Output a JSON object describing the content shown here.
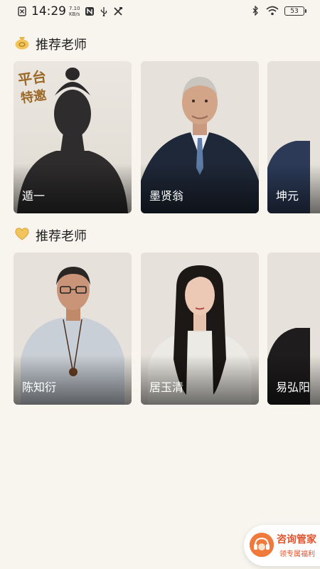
{
  "status_bar": {
    "time": "14:29",
    "net_speed_value": "7.10",
    "net_speed_unit": "KB/s",
    "battery": "53"
  },
  "sections": [
    {
      "icon": "money-bag-icon",
      "title": "推荐老师",
      "teachers": [
        {
          "name": "遁一",
          "badge_line1": "平台",
          "badge_line2": "特邀"
        },
        {
          "name": "墨贤翁"
        },
        {
          "name": "坤元"
        }
      ]
    },
    {
      "icon": "heart-icon",
      "title": "推荐老师",
      "teachers": [
        {
          "name": "陈知衍"
        },
        {
          "name": "居玉清"
        },
        {
          "name": "易弘阳"
        }
      ]
    }
  ],
  "consult": {
    "title": "咨询管家",
    "subtitle": "领专属福利"
  },
  "colors": {
    "background": "#f8f5ef",
    "accent": "#e0542c",
    "badge_gold": "#9b6a2a",
    "section_icon_gold": "#e7b44a"
  }
}
